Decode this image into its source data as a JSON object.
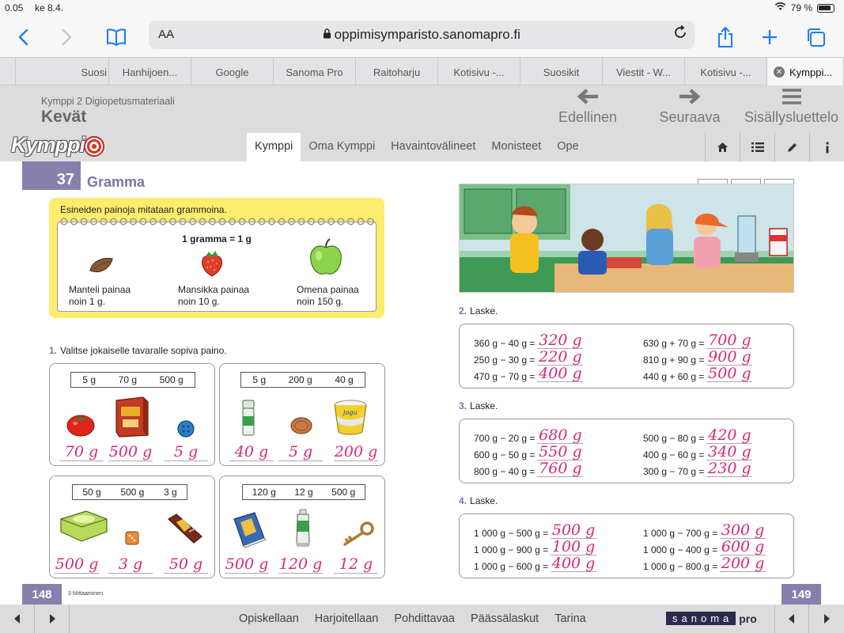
{
  "status": {
    "time": "0.05",
    "date": "ke 8.4.",
    "battery": "79 %"
  },
  "browser": {
    "aa_label": "AA",
    "url": "oppimisymparisto.sanomapro.fi",
    "tabs": [
      {
        "label": "Suosi"
      },
      {
        "label": "Hanhijoen..."
      },
      {
        "label": "Google"
      },
      {
        "label": "Sanoma Pro"
      },
      {
        "label": "Raitoharju"
      },
      {
        "label": "Kotisivu -..."
      },
      {
        "label": "Suosikit"
      },
      {
        "label": "Viestit - W..."
      },
      {
        "label": "Kotisivu -..."
      },
      {
        "label": "Kymppi..."
      }
    ]
  },
  "app": {
    "subtitle": "Kymppi 2 Digiopetusmateriaali",
    "title": "Kevät",
    "logo": "Kymppi",
    "nav": {
      "prev": "Edellinen",
      "next": "Seuraava",
      "toc": "Sisällysluettelo"
    },
    "menu": [
      {
        "label": "Kymppi"
      },
      {
        "label": "Oma Kymppi"
      },
      {
        "label": "Havaintovälineet"
      },
      {
        "label": "Monisteet"
      },
      {
        "label": "Ope"
      }
    ]
  },
  "lesson": {
    "number": "37",
    "title": "Gramma",
    "intro": "Esineiden painoja mitataan grammoina.",
    "definition": "1 gramma = 1 g",
    "examples": [
      {
        "line1": "Manteli painaa",
        "line2": "noin 1 g."
      },
      {
        "line1": "Mansikka painaa",
        "line2": "noin 10 g."
      },
      {
        "line1": "Omena painaa",
        "line2": "noin 150 g."
      }
    ]
  },
  "task1": {
    "num": "1.",
    "instruction": "Valitse jokaiselle tavaralle sopiva paino.",
    "boxes": [
      {
        "options": [
          "5 g",
          "70 g",
          "500 g"
        ],
        "answers": [
          "70 g",
          "500 g",
          "5 g"
        ]
      },
      {
        "options": [
          "5 g",
          "200 g",
          "40 g"
        ],
        "answers": [
          "40 g",
          "5 g",
          "200 g"
        ]
      },
      {
        "options": [
          "50 g",
          "500 g",
          "3 g"
        ],
        "answers": [
          "500 g",
          "3 g",
          "50 g"
        ]
      },
      {
        "options": [
          "120 g",
          "12 g",
          "500 g"
        ],
        "answers": [
          "500 g",
          "120 g",
          "12 g"
        ]
      }
    ]
  },
  "task2": {
    "num": "2.",
    "instruction": "Laske.",
    "left": [
      {
        "expr": "360 g − 40 g =",
        "ans": "320 g"
      },
      {
        "expr": "250 g − 30 g =",
        "ans": "220 g"
      },
      {
        "expr": "470 g − 70 g =",
        "ans": "400 g"
      }
    ],
    "right": [
      {
        "expr": "630 g + 70 g =",
        "ans": "700 g"
      },
      {
        "expr": "810 g + 90 g =",
        "ans": "900 g"
      },
      {
        "expr": "440 g + 60 g =",
        "ans": "500 g"
      }
    ]
  },
  "task3": {
    "num": "3.",
    "instruction": "Laske.",
    "left": [
      {
        "expr": "700 g − 20 g =",
        "ans": "680 g"
      },
      {
        "expr": "600 g − 50 g =",
        "ans": "550 g"
      },
      {
        "expr": "800 g − 40 g =",
        "ans": "760 g"
      }
    ],
    "right": [
      {
        "expr": "500 g − 80 g =",
        "ans": "420 g"
      },
      {
        "expr": "400 g − 60 g =",
        "ans": "340 g"
      },
      {
        "expr": "300 g − 70 g =",
        "ans": "230 g"
      }
    ]
  },
  "task4": {
    "num": "4.",
    "instruction": "Laske.",
    "left": [
      {
        "expr": "1 000 g − 500 g =",
        "ans": "500 g"
      },
      {
        "expr": "1 000 g − 900 g =",
        "ans": "100 g"
      },
      {
        "expr": "1 000 g − 600 g =",
        "ans": "400 g"
      }
    ],
    "right": [
      {
        "expr": "1 000 g − 700 g =",
        "ans": "300 g"
      },
      {
        "expr": "1 000 g − 400 g =",
        "ans": "600 g"
      },
      {
        "expr": "1 000 g − 800 g =",
        "ans": "200 g"
      }
    ]
  },
  "footer": {
    "page_left": "148",
    "page_right": "149",
    "chapter": "3 Mittaaminen",
    "links": [
      {
        "label": "Opiskellaan"
      },
      {
        "label": "Harjoitellaan"
      },
      {
        "label": "Pohdittavaa"
      },
      {
        "label": "Päässälaskut"
      },
      {
        "label": "Tarina"
      }
    ],
    "brand_main": "sanoma",
    "brand_pro": "pro"
  },
  "colors": {
    "accent": "#8680ad",
    "answer": "#d6287b",
    "highlight": "#fdec6e",
    "link": "#1a7cf5"
  }
}
